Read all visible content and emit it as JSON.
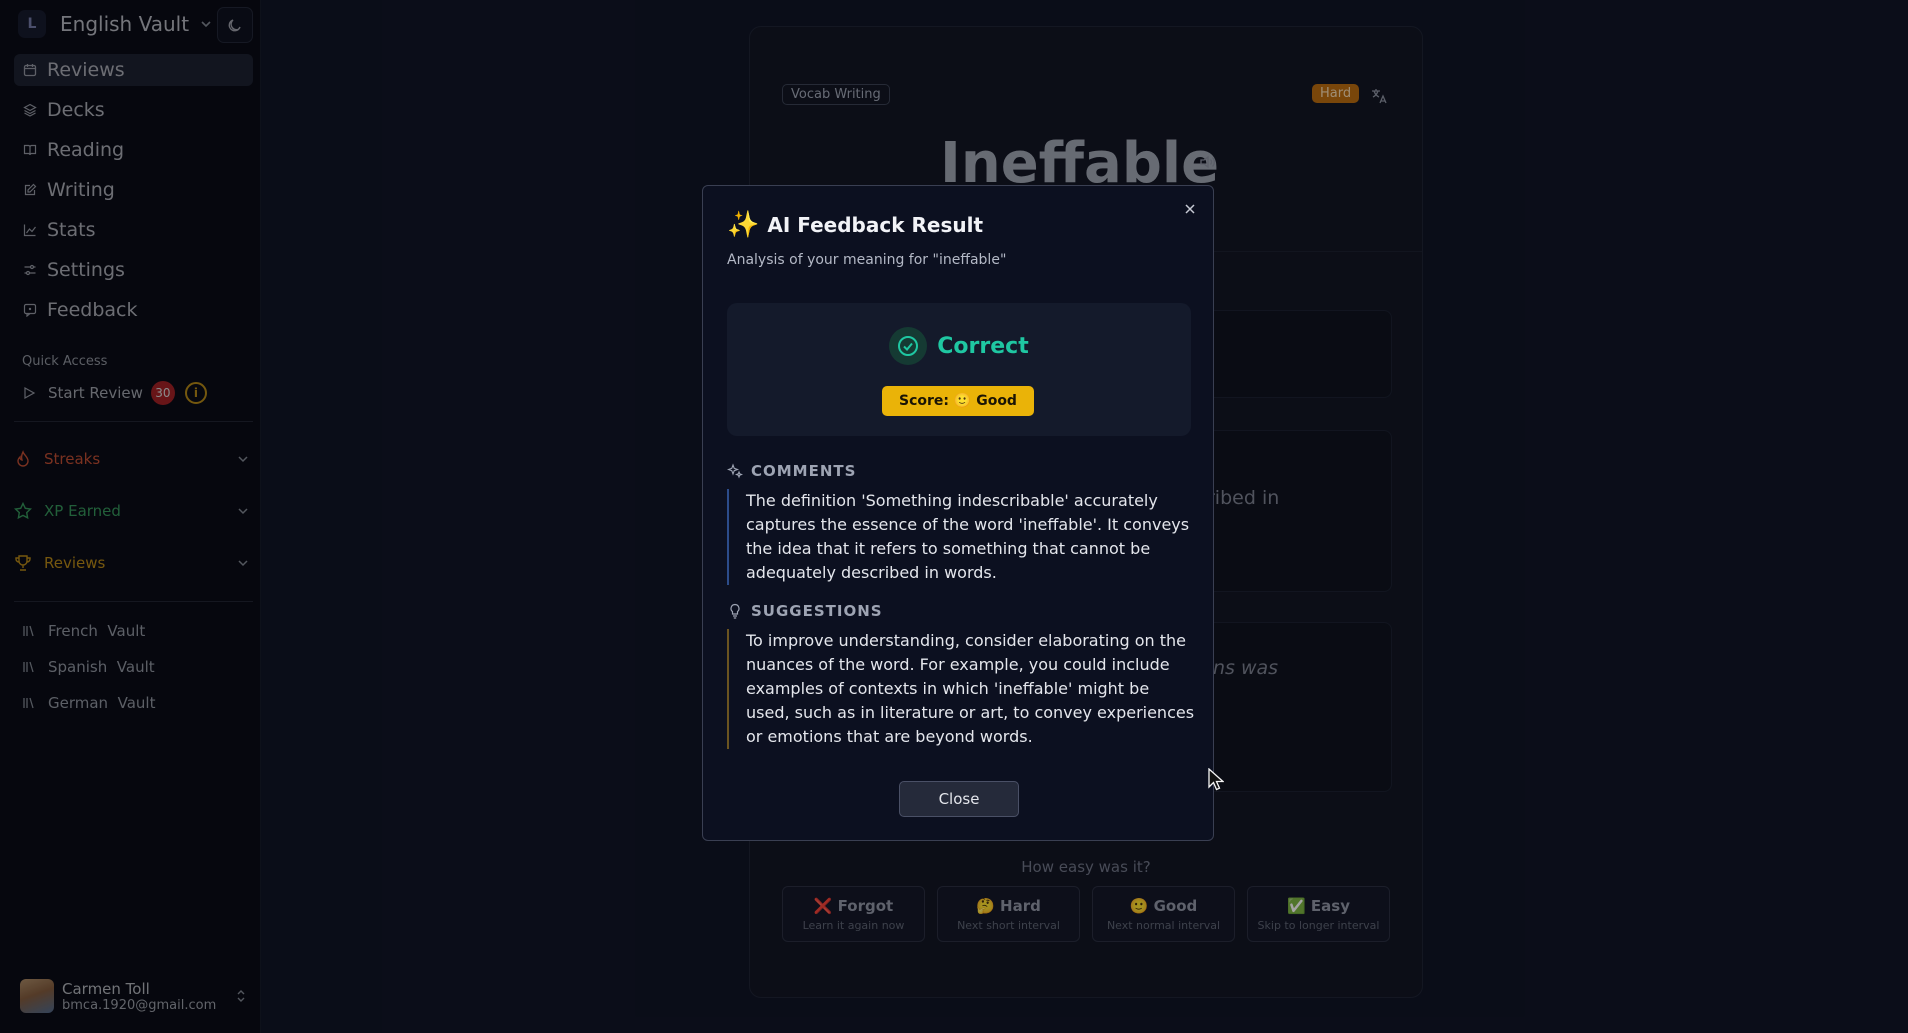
{
  "app": {
    "vault_logo_letter": "L",
    "vault_name": "English Vault"
  },
  "sidebar": {
    "nav": [
      {
        "label": "Reviews",
        "icon": "calendar-icon",
        "active": true
      },
      {
        "label": "Decks",
        "icon": "layers-icon"
      },
      {
        "label": "Reading",
        "icon": "book-icon"
      },
      {
        "label": "Writing",
        "icon": "pencil-icon"
      },
      {
        "label": "Stats",
        "icon": "chart-icon"
      },
      {
        "label": "Settings",
        "icon": "sliders-icon"
      },
      {
        "label": "Feedback",
        "icon": "message-icon"
      }
    ],
    "quick_access_label": "Quick Access",
    "start_review_label": "Start Review",
    "start_review_count": "30",
    "info_symbol": "i",
    "sections": [
      {
        "label": "Streaks",
        "icon": "flame-icon",
        "color": "#e05a3c"
      },
      {
        "label": "XP Earned",
        "icon": "star-icon",
        "color": "#3fb06a"
      },
      {
        "label": "Reviews",
        "icon": "trophy-icon",
        "color": "#d9a21b"
      }
    ],
    "vaults": [
      {
        "lang": "French",
        "suffix": "Vault"
      },
      {
        "lang": "Spanish",
        "suffix": "Vault"
      },
      {
        "lang": "German",
        "suffix": "Vault"
      }
    ],
    "user": {
      "name": "Carmen Toll",
      "email": "bmca.1920@gmail.com"
    }
  },
  "card": {
    "type_tag": "Vocab Writing",
    "difficulty_tag": "Hard",
    "word": "Ineffable",
    "ghost_text_1": "ribed in",
    "ghost_text_2": "ns was",
    "how_easy": "How easy was it?",
    "ratings": [
      {
        "emoji": "❌",
        "label": "Forgot",
        "sub": "Learn it again now"
      },
      {
        "emoji": "🤔",
        "label": "Hard",
        "sub": "Next short interval"
      },
      {
        "emoji": "🙂",
        "label": "Good",
        "sub": "Next normal interval"
      },
      {
        "emoji": "✅",
        "label": "Easy",
        "sub": "Skip to longer interval"
      }
    ]
  },
  "modal": {
    "sparkle": "✨",
    "title": "AI Feedback Result",
    "subtitle": "Analysis of your meaning for \"ineffable\"",
    "verdict": "Correct",
    "score_text": "Score: 🙂 Good",
    "comments_heading": "COMMENTS",
    "comments_body": "The definition 'Something indescribable' accurately captures the essence of the word 'ineffable'. It conveys the idea that it refers to something that cannot be adequately described in words.",
    "suggestions_heading": "SUGGESTIONS",
    "suggestions_body": "To improve understanding, consider elaborating on the nuances of the word. For example, you could include examples of contexts in which 'ineffable' might be used, such as in literature or art, to convey experiences or emotions that are beyond words.",
    "close_label": "Close"
  },
  "colors": {
    "accent_correct": "#1fc7a2",
    "score_badge": "#eab308",
    "danger_badge": "#c0272d"
  }
}
